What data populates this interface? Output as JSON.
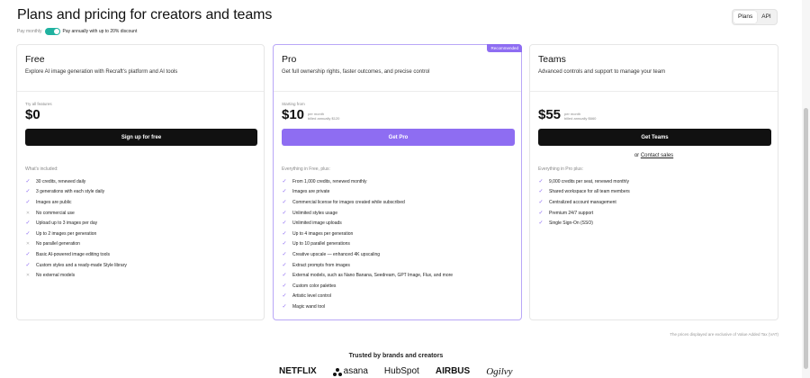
{
  "header": {
    "title": "Plans and pricing for creators and teams",
    "tabs": [
      "Plans",
      "API"
    ],
    "active_tab": "Plans"
  },
  "billing": {
    "monthly_label": "Pay monthly",
    "annual_label": "Pay annually with up to 20% discount",
    "annual_selected": true
  },
  "plans": [
    {
      "name": "Free",
      "description": "Explore AI image generation with Recraft's platform and AI tools",
      "price_prefix": "Try all features",
      "price": "$0",
      "price_note_1": "",
      "price_note_2": "",
      "cta": "Sign up for free",
      "features_heading": "What's included:",
      "features": [
        {
          "text": "30 credits, renewed daily",
          "included": true
        },
        {
          "text": "3 generations with each style daily",
          "included": true
        },
        {
          "text": "Images are public",
          "included": true
        },
        {
          "text": "No commercial use",
          "included": false
        },
        {
          "text": "Upload up to 3 images per day",
          "included": true
        },
        {
          "text": "Up to 2 images per generation",
          "included": true
        },
        {
          "text": "No parallel generation",
          "included": false
        },
        {
          "text": "Basic AI-powered image editing tools",
          "included": true
        },
        {
          "text": "Custom styles and a ready-made Style library",
          "included": true
        },
        {
          "text": "No external models",
          "included": false
        }
      ]
    },
    {
      "name": "Pro",
      "badge": "Recommended",
      "description": "Get full ownership rights, faster outcomes, and precise control",
      "price_prefix": "Starting from",
      "price": "$10",
      "price_note_1": "per month",
      "price_note_2": "billed annually $120",
      "cta": "Get Pro",
      "features_heading": "Everything in Free, plus:",
      "features": [
        {
          "text": "From 1,000 credits, renewed monthly",
          "included": true
        },
        {
          "text": "Images are private",
          "included": true
        },
        {
          "text": "Commercial license for images created while subscribed",
          "included": true
        },
        {
          "text": "Unlimited styles usage",
          "included": true
        },
        {
          "text": "Unlimited image uploads",
          "included": true
        },
        {
          "text": "Up to 4 images per generation",
          "included": true
        },
        {
          "text": "Up to 10 parallel generations",
          "included": true
        },
        {
          "text": "Creative upscale — enhanced 4K upscaling",
          "included": true
        },
        {
          "text": "Extract prompts from images",
          "included": true
        },
        {
          "text": "External models, such as Nano Banana, Seedream, GPT Image, Flux, and more",
          "included": true
        },
        {
          "text": "Custom color palettes",
          "included": true
        },
        {
          "text": "Artistic level control",
          "included": true
        },
        {
          "text": "Magic wand tool",
          "included": true
        }
      ]
    },
    {
      "name": "Teams",
      "description": "Advanced controls and support to manage your team",
      "price_prefix": "",
      "price": "$55",
      "price_note_1": "per month",
      "price_note_2": "billed annually $660",
      "cta": "Get Teams",
      "contact_prefix": "or",
      "contact_link": "Contact sales",
      "features_heading": "Everything in Pro plus:",
      "features": [
        {
          "text": "9,000 credits per seat, renewed monthly",
          "included": true
        },
        {
          "text": "Shared workspace for all team members",
          "included": true
        },
        {
          "text": "Centralized account management",
          "included": true
        },
        {
          "text": "Premium 24/7 support",
          "included": true
        },
        {
          "text": "Single Sign-On (SSO)",
          "included": true
        }
      ]
    }
  ],
  "footer": {
    "vat_note": "The prices displayed are exclusive of Value Added Tax (VAT)",
    "trusted_heading": "Trusted by brands and creators",
    "logos": [
      "NETFLIX",
      "asana",
      "HubSpot",
      "AIRBUS",
      "Ogilvy"
    ]
  },
  "colors": {
    "accent": "#8e6df2",
    "toggle": "#20b2a0",
    "dark_button": "#111111"
  }
}
